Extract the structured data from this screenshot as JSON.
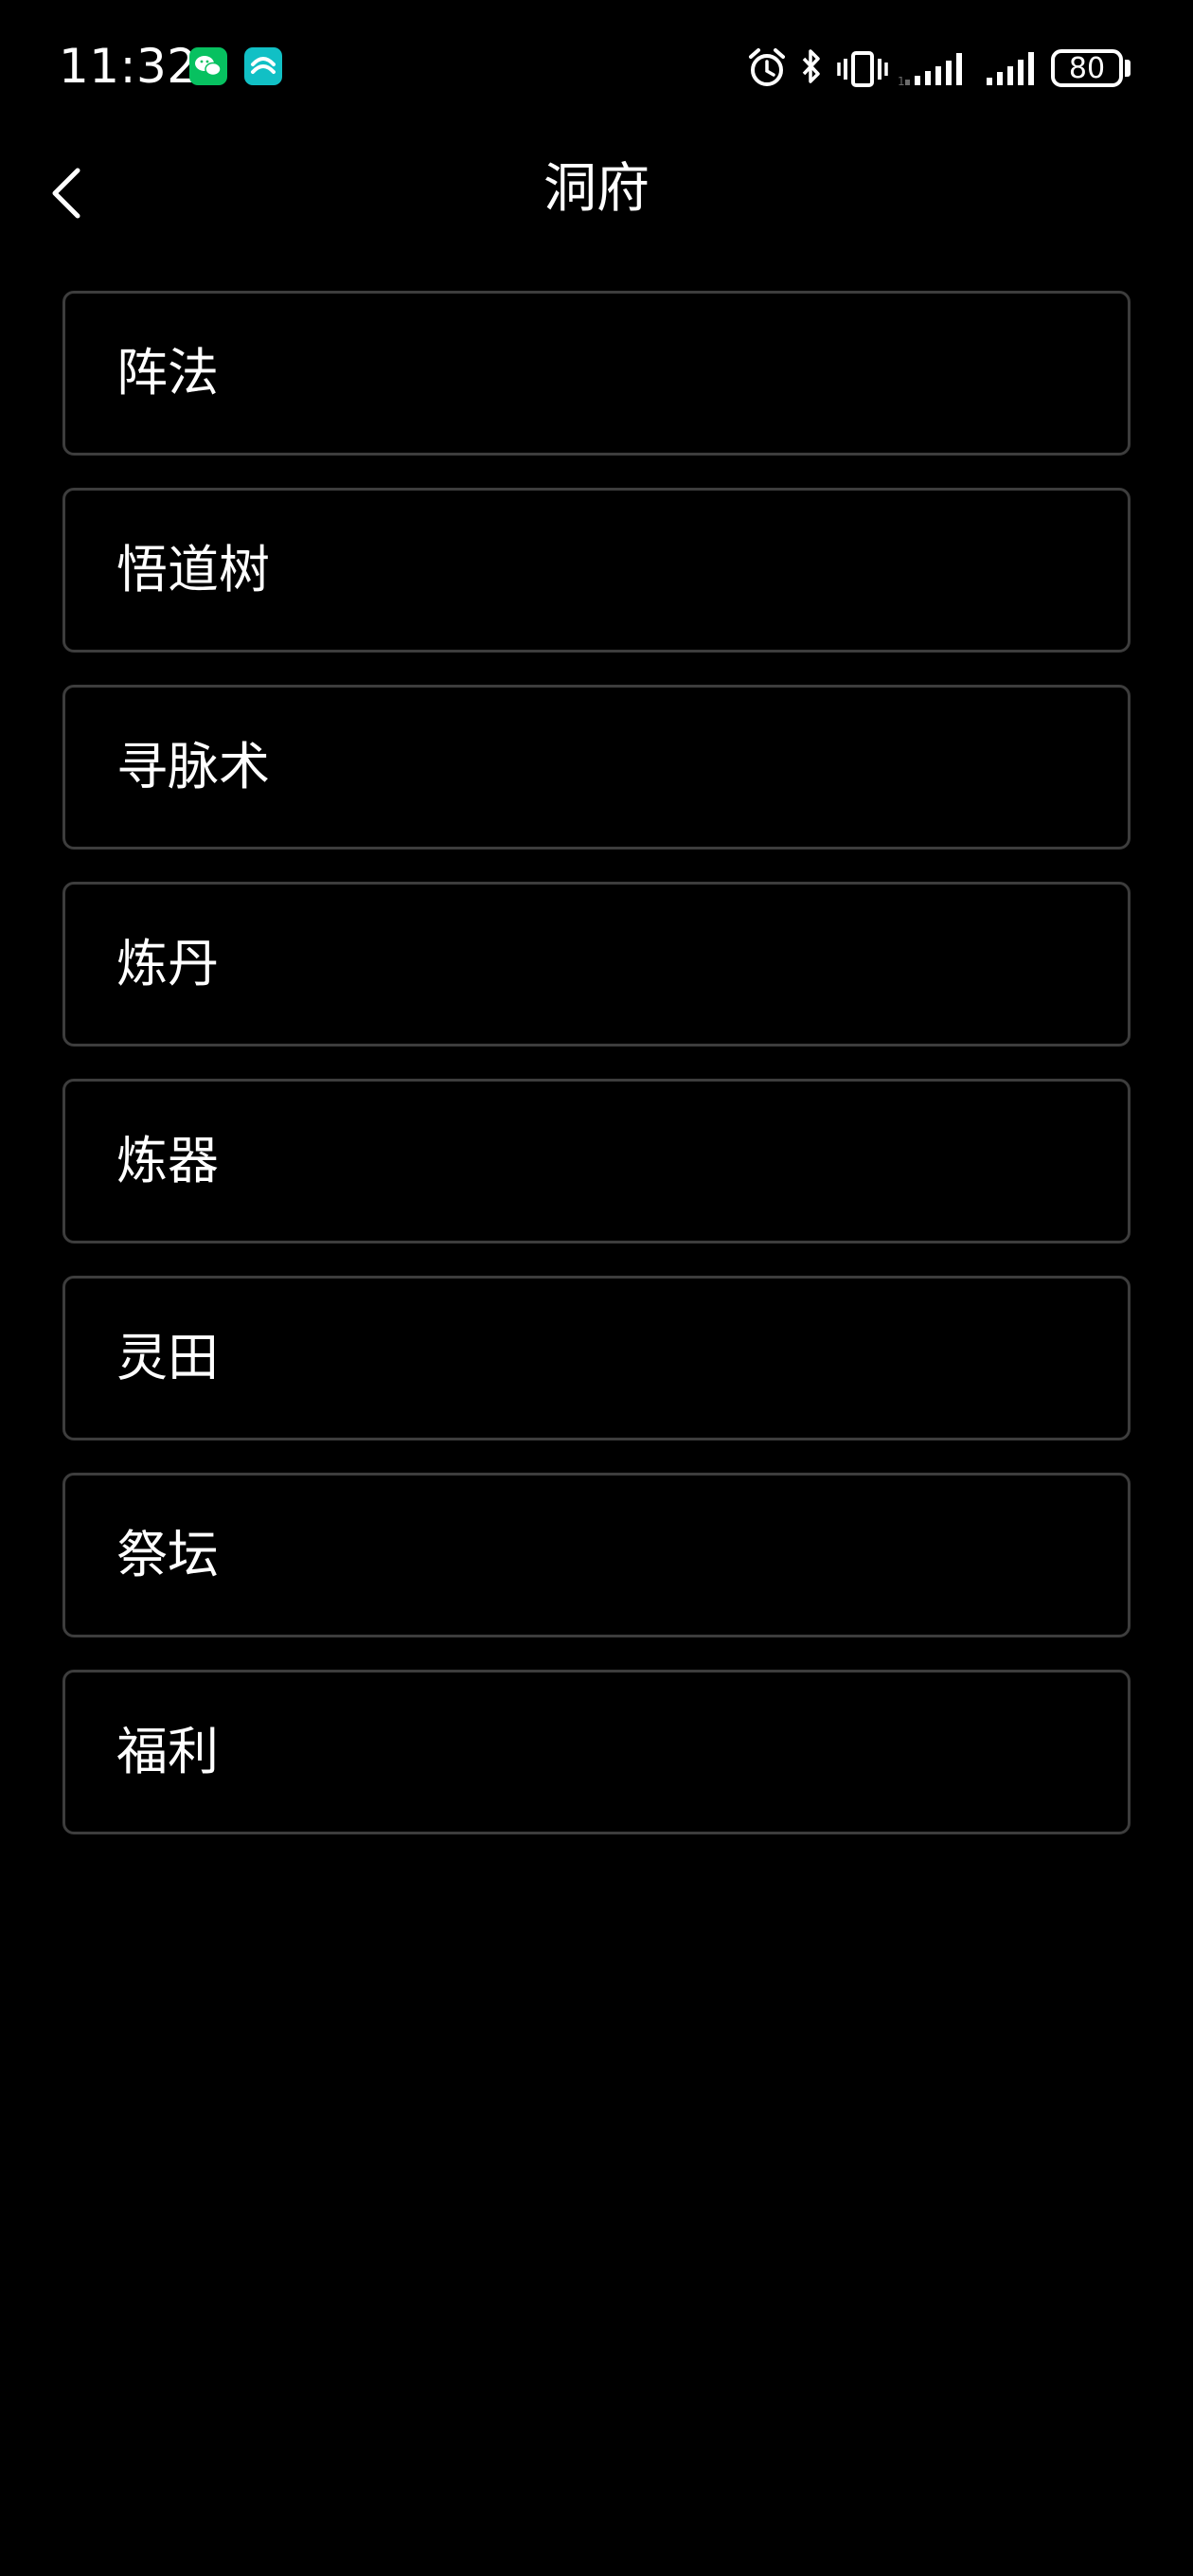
{
  "status_bar": {
    "time": "11:32",
    "battery": "80",
    "icons": [
      "wechat-icon",
      "app-icon",
      "alarm-icon",
      "bluetooth-icon",
      "vibrate-icon",
      "cell-signal-icon",
      "cell-signal-icon"
    ]
  },
  "header": {
    "title": "洞府",
    "back_icon": "chevron-left-icon"
  },
  "menu": {
    "items": [
      {
        "label": "阵法"
      },
      {
        "label": "悟道树"
      },
      {
        "label": "寻脉术"
      },
      {
        "label": "炼丹"
      },
      {
        "label": "炼器"
      },
      {
        "label": "灵田"
      },
      {
        "label": "祭坛"
      },
      {
        "label": "福利"
      }
    ]
  },
  "colors": {
    "background": "#000000",
    "text": "#ffffff",
    "item_border": "#3d3d3d",
    "wechat": "#07c160",
    "app_icon": "#11c0c5"
  }
}
